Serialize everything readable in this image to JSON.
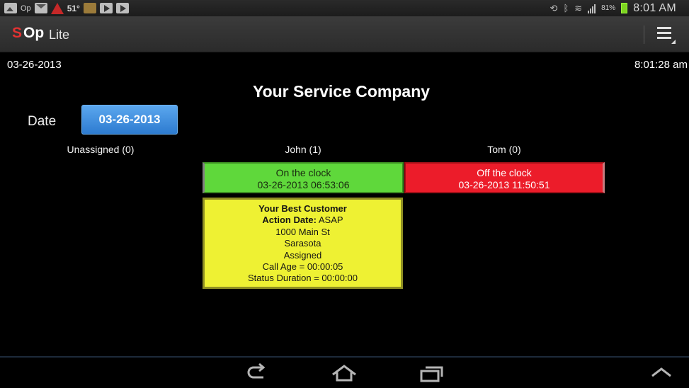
{
  "status_bar": {
    "icons_left": [
      "image-icon",
      "op-app-icon",
      "mail-icon",
      "warning-icon",
      "weather-icon",
      "puzzle-icon",
      "video-icon",
      "play-icon"
    ],
    "op_label": "Op",
    "temperature": "51°",
    "battery_percent": "81%",
    "clock": "8:01 AM",
    "icons_right": [
      "sync-icon",
      "bluetooth-icon",
      "wifi-icon",
      "signal-icon",
      "battery-icon"
    ]
  },
  "action_bar": {
    "logo_s": "S",
    "logo_op": "Op",
    "title": "Lite",
    "menu_icon": "overflow-menu-icon"
  },
  "header": {
    "current_date": "03-26-2013",
    "current_time": "8:01:28 am",
    "company_name": "Your Service Company"
  },
  "date_picker": {
    "label": "Date",
    "value": "03-26-2013"
  },
  "columns": [
    {
      "heading": "Unassigned (0)"
    },
    {
      "heading": "John (1)",
      "status_line1": "On the clock",
      "status_line2": "03-26-2013 06:53:06",
      "status_color": "#5fd83b"
    },
    {
      "heading": "Tom (0)",
      "status_line1": "Off the clock",
      "status_line2": "03-26-2013 11:50:51",
      "status_color": "#ec1c2a"
    }
  ],
  "job": {
    "customer": "Your Best Customer",
    "action_date_label": "Action Date:",
    "action_date_value": "ASAP",
    "address": "1000 Main St",
    "city": "Sarasota",
    "status": "Assigned",
    "call_age": "Call Age = 00:00:05",
    "status_duration": "Status Duration = 00:00:00",
    "color": "#eef133"
  },
  "nav_bar": {
    "icons": [
      "back-icon",
      "home-icon",
      "recent-apps-icon",
      "up-chevron-icon"
    ]
  }
}
